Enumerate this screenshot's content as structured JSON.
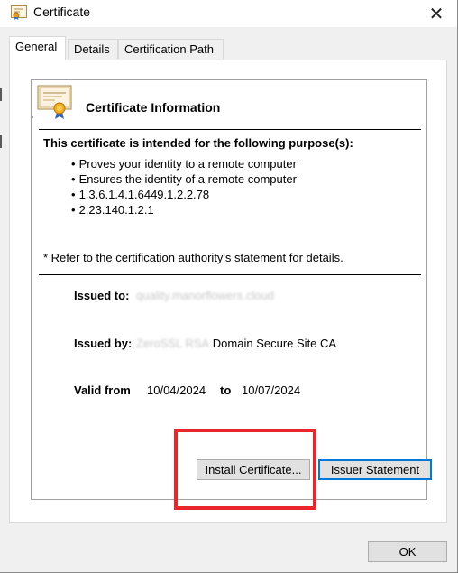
{
  "window": {
    "title": "Certificate",
    "close_glyph": "✕"
  },
  "tabs": [
    {
      "label": "General",
      "active": true
    },
    {
      "label": "Details",
      "active": false
    },
    {
      "label": "Certification Path",
      "active": false
    }
  ],
  "info": {
    "heading": "Certificate Information",
    "purpose_heading": "This certificate is intended for the following purpose(s):",
    "purposes": [
      "Proves your identity to a remote computer",
      "Ensures the identity of a remote computer",
      "1.3.6.1.4.1.6449.1.2.2.78",
      "2.23.140.1.2.1"
    ],
    "note": "* Refer to the certification authority's statement for details."
  },
  "fields": {
    "issued_to_label": "Issued to:",
    "issued_to_value": "quality.manorflowers.cloud",
    "issued_by_label": "Issued by:",
    "issued_by_redacted": "ZeroSSL RSA",
    "issued_by_value": "Domain Secure Site CA",
    "valid_from_label": "Valid from",
    "valid_from_value": "10/04/2024",
    "valid_to_label": "to",
    "valid_to_value": "10/07/2024"
  },
  "buttons": {
    "install": "Install Certificate...",
    "issuer_statement": "Issuer Statement",
    "ok": "OK"
  },
  "colors": {
    "highlight": "#e8262b",
    "focus": "#0078d7"
  },
  "icons": {
    "title_icon": "certificate-icon",
    "info_icon": "certificate-ribbon-icon",
    "close": "close-icon"
  }
}
